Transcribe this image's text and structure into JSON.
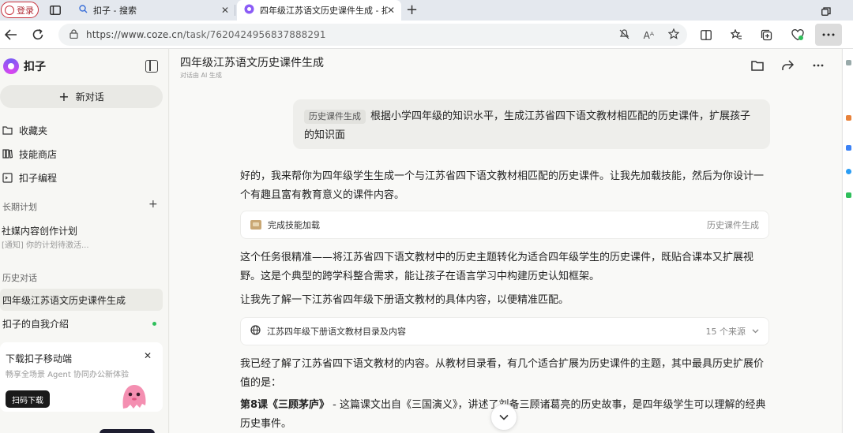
{
  "browser": {
    "login_label": "登录",
    "tabs": [
      {
        "title": "扣子 - 搜索",
        "active": false
      },
      {
        "title": "四年级江苏语文历史课件生成 - 扣",
        "active": true
      }
    ],
    "url_host": "https://www.coze.cn",
    "url_path": "/task/7620424956837888291",
    "reader_label": "Aᴬ"
  },
  "sidebar": {
    "brand": "扣子",
    "new_chat": "新对话",
    "nav": [
      "收藏夹",
      "技能商店",
      "扣子编程"
    ],
    "long_plan_label": "长期计划",
    "plan_title": "社媒内容创作计划",
    "plan_sub": "[通知] 你的计划待激活...",
    "history_label": "历史对话",
    "history": [
      "四年级江苏语文历史课件生成",
      "扣子的自我介绍"
    ],
    "promo": {
      "title": "下载扣子移动端",
      "sub": "畅享全场景 Agent 协同办公新体验",
      "button": "扫码下载"
    }
  },
  "chat": {
    "title": "四年级江苏语文历史课件生成",
    "subtitle": "对话由 AI 生成",
    "user_tag": "历史课件生成",
    "user_message": "根据小学四年级的知识水平，生成江苏省四下语文教材相匹配的历史课件，扩展孩子的知识面",
    "reply_1": "好的，我来帮你为四年级学生生成一个与江苏省四下语文教材相匹配的历史课件。让我先加载技能，然后为你设计一个有趣且富有教育意义的课件内容。",
    "skill_card_label": "完成技能加载",
    "skill_card_right": "历史课件生成",
    "reply_2": "这个任务很精准——将江苏省四下语文教材中的历史主题转化为适合四年级学生的历史课件，既贴合课本又扩展视野。这是个典型的跨学科整合需求，能让孩子在语言学习中构建历史认知框架。",
    "reply_3": "让我先了解一下江苏省四年级下册语文教材的具体内容，以便精准匹配。",
    "search_card_label": "江苏四年级下册语文教材目录及内容",
    "search_card_right": "15 个来源",
    "reply_4": "我已经了解了江苏省四下语文教材的内容。从教材目录看，有几个适合扩展为历史课件的主题，其中最具历史扩展价值的是：",
    "reply_5_bold": "第8课《三顾茅庐》",
    "reply_5": " - 这篇课文出自《三国演义》，讲述了刘备三顾诸葛亮的历史故事，是四年级学生可以理解的经典历史事件。"
  },
  "colors": {
    "accent_red": "#c8323d",
    "brand_purple": "#7b5cf5",
    "online_green": "#2fbf5b"
  }
}
